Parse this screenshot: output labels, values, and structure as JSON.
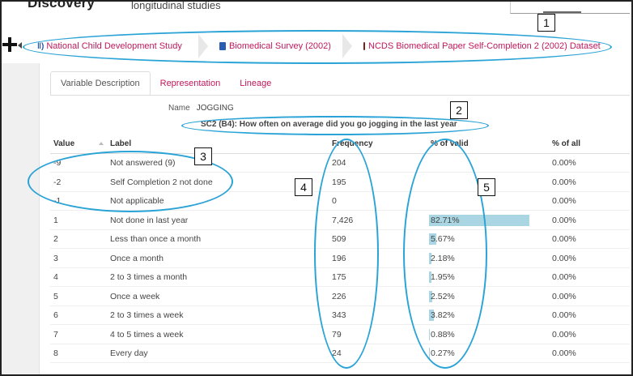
{
  "header": {
    "brand": "Discovery",
    "subtitle": "longitudinal studies"
  },
  "breadcrumb": [
    {
      "label": "National Child Development Study",
      "icon": "study-icon"
    },
    {
      "label": "Biomedical Survey (2002)",
      "icon": "book-icon"
    },
    {
      "label": "NCDS Biomedical Paper Self-Completion 2 (2002) Dataset",
      "icon": "dataset-icon"
    }
  ],
  "tabs": [
    {
      "label": "Variable Description",
      "active": true
    },
    {
      "label": "Representation",
      "active": false
    },
    {
      "label": "Lineage",
      "active": false
    }
  ],
  "variable": {
    "name_label": "Name",
    "name_value": "JOGGING",
    "question": "SC2 (B4): How often on average did you go jogging in the last year"
  },
  "table": {
    "headers": {
      "value": "Value",
      "label": "Label",
      "frequency": "Frequency",
      "pct_valid": "% of valid",
      "pct_all": "% of all"
    },
    "rows": [
      {
        "value": "-9",
        "label": "Not answered (9)",
        "frequency": "204",
        "pct_valid": "",
        "pct_valid_num": 0,
        "pct_all": "0.00%"
      },
      {
        "value": "-2",
        "label": "Self Completion 2 not done",
        "frequency": "195",
        "pct_valid": "",
        "pct_valid_num": 0,
        "pct_all": "0.00%"
      },
      {
        "value": "-1",
        "label": "Not applicable",
        "frequency": "0",
        "pct_valid": "",
        "pct_valid_num": 0,
        "pct_all": "0.00%"
      },
      {
        "value": "1",
        "label": "Not done in last year",
        "frequency": "7,426",
        "pct_valid": "82.71%",
        "pct_valid_num": 82.71,
        "pct_all": "0.00%"
      },
      {
        "value": "2",
        "label": "Less than once a month",
        "frequency": "509",
        "pct_valid": "5.67%",
        "pct_valid_num": 5.67,
        "pct_all": "0.00%"
      },
      {
        "value": "3",
        "label": "Once a month",
        "frequency": "196",
        "pct_valid": "2.18%",
        "pct_valid_num": 2.18,
        "pct_all": "0.00%"
      },
      {
        "value": "4",
        "label": "2 to 3 times a month",
        "frequency": "175",
        "pct_valid": "1.95%",
        "pct_valid_num": 1.95,
        "pct_all": "0.00%"
      },
      {
        "value": "5",
        "label": "Once a week",
        "frequency": "226",
        "pct_valid": "2.52%",
        "pct_valid_num": 2.52,
        "pct_all": "0.00%"
      },
      {
        "value": "6",
        "label": "2 to 3 times a week",
        "frequency": "343",
        "pct_valid": "3.82%",
        "pct_valid_num": 3.82,
        "pct_all": "0.00%"
      },
      {
        "value": "7",
        "label": "4 to 5 times a week",
        "frequency": "79",
        "pct_valid": "0.88%",
        "pct_valid_num": 0.88,
        "pct_all": "0.00%"
      },
      {
        "value": "8",
        "label": "Every day",
        "frequency": "24",
        "pct_valid": "0.27%",
        "pct_valid_num": 0.27,
        "pct_all": "0.00%"
      }
    ]
  },
  "callouts": [
    "1",
    "2",
    "3",
    "4",
    "5"
  ],
  "colors": {
    "link": "#c2185b",
    "callout": "#2aa3d6",
    "bar": "#a9d6e2"
  }
}
